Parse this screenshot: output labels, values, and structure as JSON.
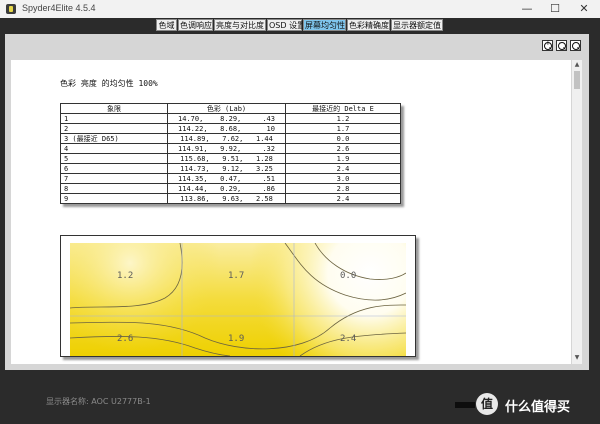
{
  "window": {
    "title": "Spyder4Elite 4.5.4",
    "controls": {
      "minimize": "—",
      "maximize": "☐",
      "close": "✕"
    }
  },
  "tabs": [
    {
      "label": "色域",
      "active": false
    },
    {
      "label": "色调响应",
      "active": false
    },
    {
      "label": "亮度与对比度",
      "active": false
    },
    {
      "label": "OSD 设置",
      "active": false
    },
    {
      "label": "屏幕均匀性",
      "active": true
    },
    {
      "label": "色彩精确度",
      "active": false
    },
    {
      "label": "显示器额定值",
      "active": false
    }
  ],
  "toolbar": {
    "icons": [
      "zoom-in-icon",
      "zoom-out-icon",
      "zoom-fit-icon"
    ]
  },
  "report": {
    "title": "色彩 亮度 的均匀性 100%",
    "table": {
      "headers": [
        "象限",
        "色彩 (Lab)",
        "最接近的 Delta E"
      ],
      "rows": [
        [
          "1",
          "14.70,    8.29,     .43",
          "1.2"
        ],
        [
          "2",
          "114.22,   8.68,      10",
          "1.7"
        ],
        [
          "3 (最接近 D65)",
          "114.89,   7.62,   1.44",
          "0.0"
        ],
        [
          "4",
          "114.91,   9.92,     .32",
          "2.6"
        ],
        [
          "5",
          "115.68,   9.51,   1.28",
          "1.9"
        ],
        [
          "6",
          "114.73,   9.12,   3.25",
          "2.4"
        ],
        [
          "7",
          "114.35,   0.47,     .51",
          "3.0"
        ],
        [
          "8",
          "114.44,   0.29,     .86",
          "2.8"
        ],
        [
          "9",
          "113.86,   9.63,   2.58",
          "2.4"
        ]
      ]
    },
    "heatmap": {
      "values": [
        "1.2",
        "1.7",
        "0.0",
        "2.6",
        "1.9",
        "2.4"
      ],
      "colors": {
        "low": "#ffffff",
        "high": "#f1d200"
      }
    }
  },
  "footer": {
    "display_name": "显示器名称: AOC U2777B-1",
    "watermark_logo": "值",
    "watermark_text": "什么值得买"
  }
}
